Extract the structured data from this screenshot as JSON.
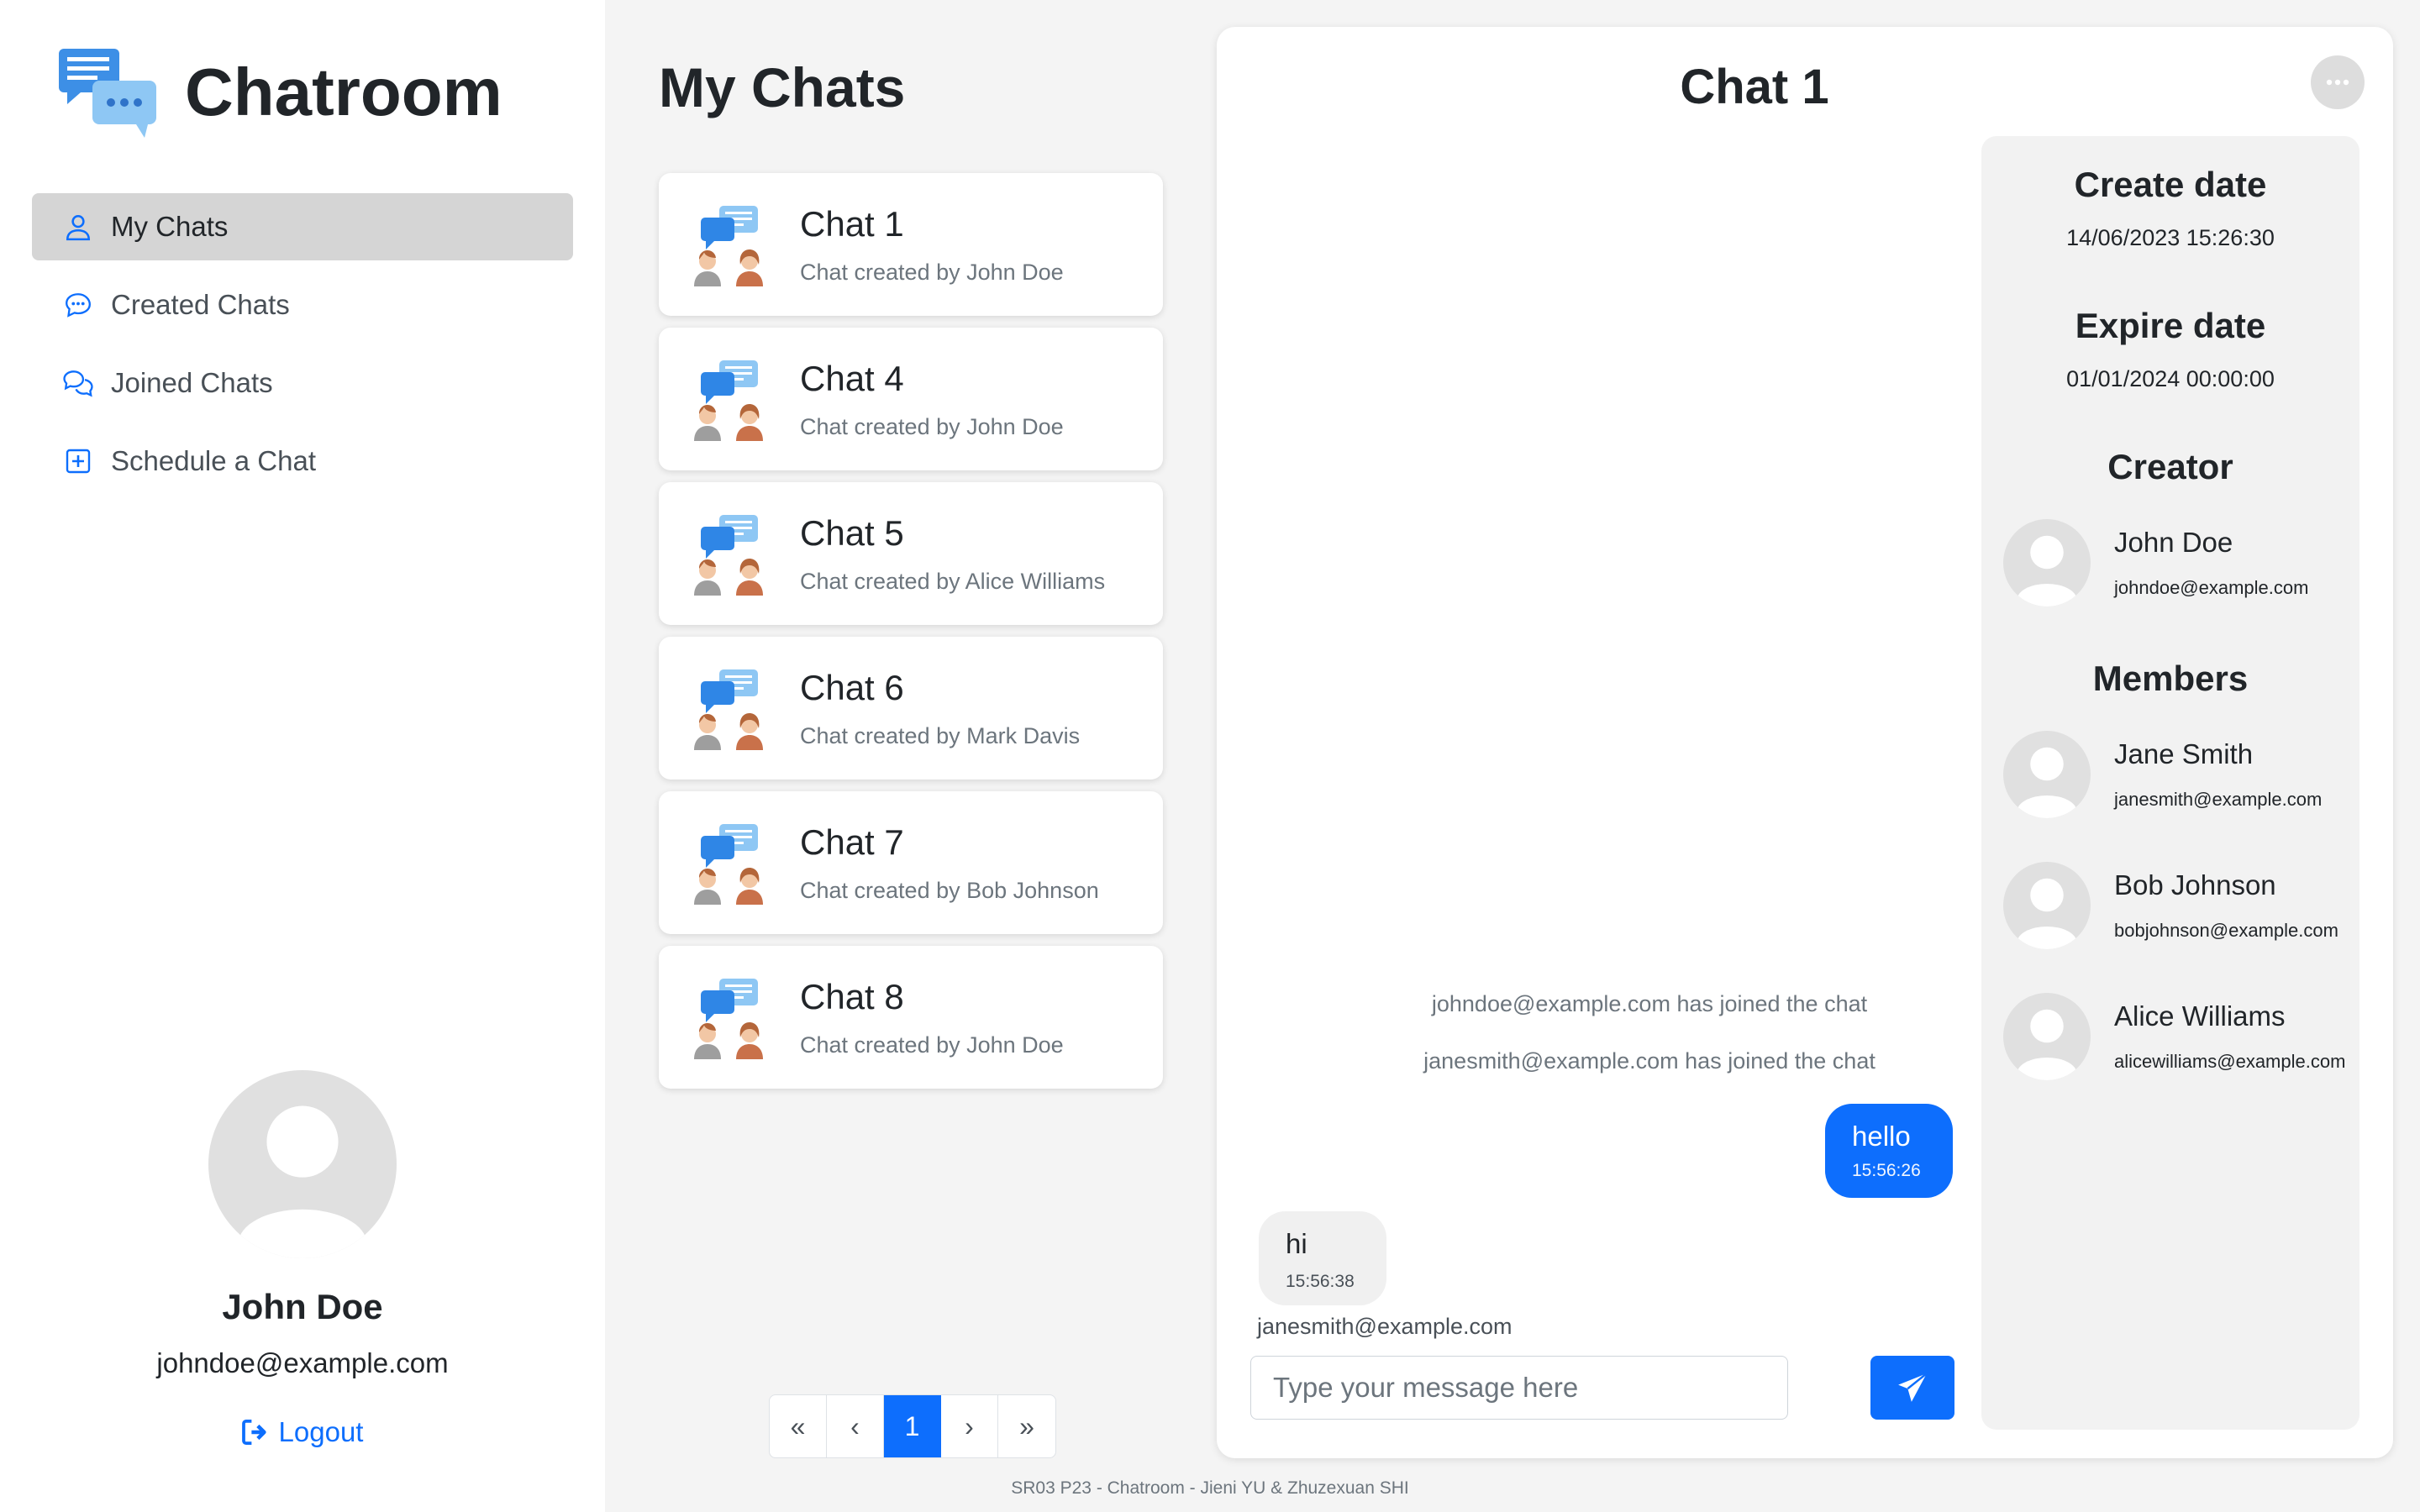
{
  "app": {
    "title": "Chatroom"
  },
  "nav": {
    "items": [
      {
        "label": "My Chats",
        "icon": "user-icon",
        "active": true
      },
      {
        "label": "Created Chats",
        "icon": "chat-dots-icon",
        "active": false
      },
      {
        "label": "Joined Chats",
        "icon": "chats-icon",
        "active": false
      },
      {
        "label": "Schedule a Chat",
        "icon": "plus-square-icon",
        "active": false
      }
    ]
  },
  "profile": {
    "name": "John Doe",
    "email": "johndoe@example.com",
    "logout_label": "Logout"
  },
  "chat_list": {
    "title": "My Chats",
    "chats": [
      {
        "name": "Chat 1",
        "subtitle": "Chat created by John Doe"
      },
      {
        "name": "Chat 4",
        "subtitle": "Chat created by John Doe"
      },
      {
        "name": "Chat 5",
        "subtitle": "Chat created by Alice Williams"
      },
      {
        "name": "Chat 6",
        "subtitle": "Chat created by Mark Davis"
      },
      {
        "name": "Chat 7",
        "subtitle": "Chat created by Bob Johnson"
      },
      {
        "name": "Chat 8",
        "subtitle": "Chat created by John Doe"
      }
    ],
    "pagination": {
      "first": "«",
      "prev": "‹",
      "current": "1",
      "next": "›",
      "last": "»"
    }
  },
  "chat": {
    "title": "Chat 1",
    "system_messages": [
      "johndoe@example.com has joined the chat",
      "janesmith@example.com has joined the chat"
    ],
    "outgoing": {
      "text": "hello",
      "time": "15:56:26"
    },
    "incoming": {
      "text": "hi",
      "time": "15:56:38",
      "sender": "janesmith@example.com"
    },
    "input_placeholder": "Type your message here",
    "accent_color": "#0d6efd"
  },
  "info": {
    "create_label": "Create date",
    "create_value": "14/06/2023 15:26:30",
    "expire_label": "Expire date",
    "expire_value": "01/01/2024 00:00:00",
    "creator_label": "Creator",
    "creator": {
      "name": "John Doe",
      "email": "johndoe@example.com"
    },
    "members_label": "Members",
    "members": [
      {
        "name": "Jane Smith",
        "email": "janesmith@example.com"
      },
      {
        "name": "Bob Johnson",
        "email": "bobjohnson@example.com"
      },
      {
        "name": "Alice Williams",
        "email": "alicewilliams@example.com"
      }
    ]
  },
  "footer": {
    "text": "SR03 P23 - Chatroom - Jieni YU & Zhuzexuan SHI"
  }
}
